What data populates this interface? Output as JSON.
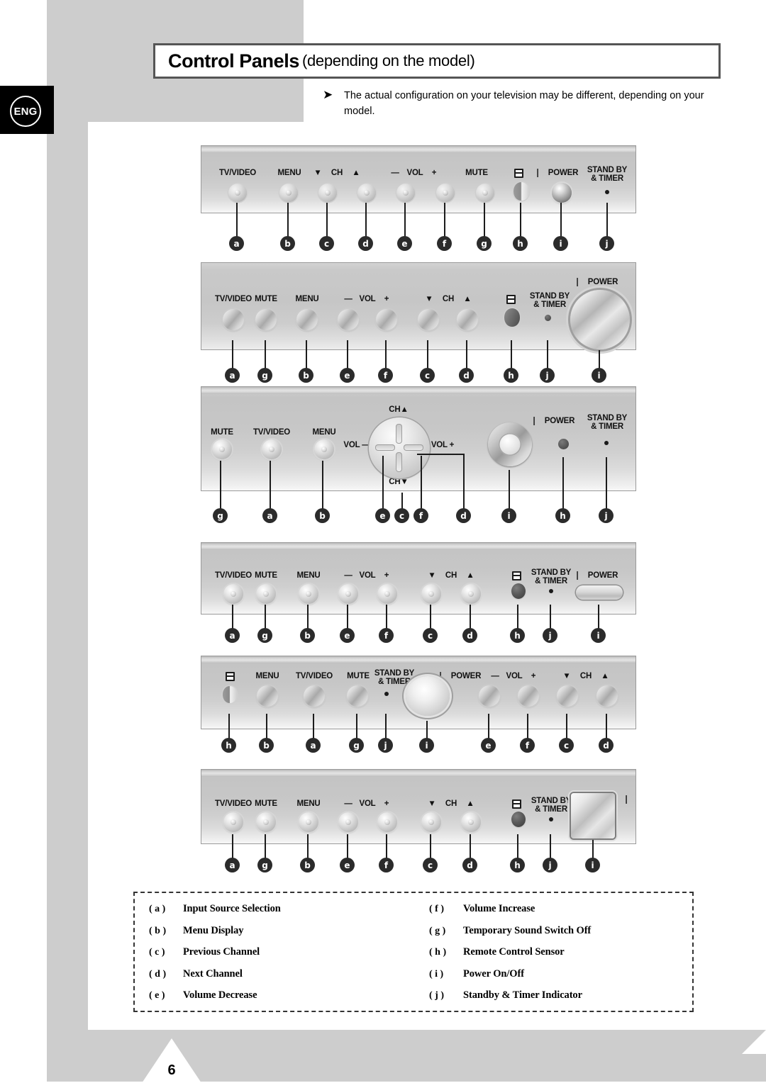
{
  "page": {
    "language_badge": "ENG",
    "page_number": "6"
  },
  "header": {
    "title_main": "Control Panels",
    "title_sub": "(depending on the model)",
    "note_arrow": "➤",
    "note_text": "The actual configuration on your television may be different, depending on your model."
  },
  "labels": {
    "tv_video": "TV/VIDEO",
    "menu": "MENU",
    "mute": "MUTE",
    "vol": "VOL",
    "ch": "CH",
    "minus": "—",
    "plus": "+",
    "down": "▼",
    "up": "▲",
    "power": "POWER",
    "power_bar": "❘",
    "standby_line1": "STAND BY",
    "standby_line2": "& TIMER",
    "ch_up": "CH▲",
    "ch_down": "CH▼",
    "vol_minus": "VOL —",
    "vol_plus": "VOL +"
  },
  "panels": [
    {
      "id": "panel-1",
      "callouts": [
        "a",
        "b",
        "c",
        "d",
        "e",
        "f",
        "g",
        "h",
        "i",
        "j"
      ]
    },
    {
      "id": "panel-2",
      "callouts": [
        "a",
        "g",
        "b",
        "e",
        "f",
        "c",
        "d",
        "h",
        "j",
        "i"
      ]
    },
    {
      "id": "panel-3",
      "callouts": [
        "g",
        "a",
        "b",
        "e",
        "c",
        "f",
        "d",
        "i",
        "h",
        "j"
      ]
    },
    {
      "id": "panel-4",
      "callouts": [
        "a",
        "g",
        "b",
        "e",
        "f",
        "c",
        "d",
        "h",
        "j",
        "i"
      ]
    },
    {
      "id": "panel-5",
      "callouts": [
        "h",
        "b",
        "a",
        "g",
        "j",
        "i",
        "e",
        "f",
        "c",
        "d"
      ]
    },
    {
      "id": "panel-6",
      "callouts": [
        "a",
        "g",
        "b",
        "e",
        "f",
        "c",
        "d",
        "h",
        "j",
        "i"
      ]
    }
  ],
  "legend": {
    "left": [
      {
        "key": "( a )",
        "text": "Input Source Selection"
      },
      {
        "key": "( b )",
        "text": "Menu Display"
      },
      {
        "key": "( c )",
        "text": "Previous Channel"
      },
      {
        "key": "( d )",
        "text": "Next Channel"
      },
      {
        "key": "( e )",
        "text": "Volume Decrease"
      }
    ],
    "right": [
      {
        "key": "( f )",
        "text": "Volume Increase"
      },
      {
        "key": "( g )",
        "text": "Temporary Sound Switch Off"
      },
      {
        "key": "( h )",
        "text": "Remote Control Sensor"
      },
      {
        "key": "( i )",
        "text": "Power On/Off"
      },
      {
        "key": "( j )",
        "text": "Standby &amp; Timer Indicator"
      }
    ]
  },
  "colors": {
    "page_gray": "#cdcdcd",
    "bezel_gray": "#c6c6c6",
    "ink": "#1c1c1c"
  }
}
